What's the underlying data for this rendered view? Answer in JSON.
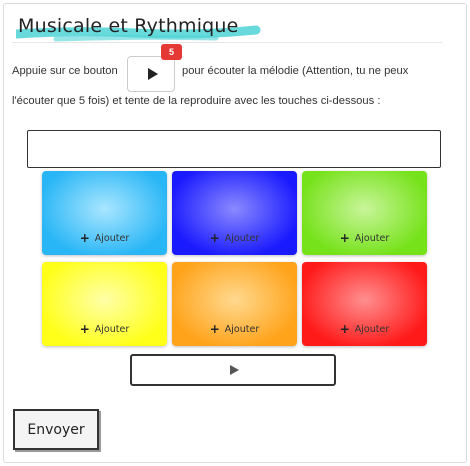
{
  "title": "Musicale et Rythmique",
  "accent_color": "#4fd3d6",
  "instructions": {
    "before_button": "Appuie sur ce bouton",
    "after_button": "pour écouter la mélodie (Attention, tu ne peux",
    "line2": "l'écouter que 5 fois) et tente de la reproduire avec les touches ci-dessous :"
  },
  "listen_button": {
    "icon": "play-icon",
    "remaining_badge": "5"
  },
  "answer_field": {
    "value": ""
  },
  "tiles": [
    {
      "id": "cyan",
      "color": "#29b6f6",
      "center": "#a9e6ff",
      "add_label": "Ajouter"
    },
    {
      "id": "blue",
      "color": "#1a1aff",
      "center": "#8a8aff",
      "add_label": "Ajouter"
    },
    {
      "id": "green",
      "color": "#76e21a",
      "center": "#c8f59a",
      "add_label": "Ajouter"
    },
    {
      "id": "yellow",
      "color": "#ffff1a",
      "center": "#ffffa8",
      "add_label": "Ajouter"
    },
    {
      "id": "orange",
      "color": "#ffa31a",
      "center": "#ffd98f",
      "add_label": "Ajouter"
    },
    {
      "id": "red",
      "color": "#ff1a1a",
      "center": "#ff8f8f",
      "add_label": "Ajouter"
    }
  ],
  "melody_play_button": {
    "icon": "play-icon"
  },
  "submit_button": {
    "label": "Envoyer"
  }
}
